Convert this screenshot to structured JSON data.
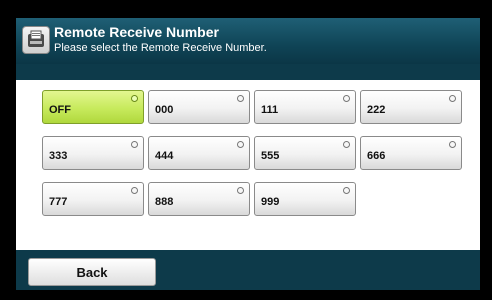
{
  "header": {
    "title": "Remote Receive Number",
    "subtitle": "Please select the Remote Receive Number.",
    "icon": "fax-document-icon"
  },
  "options": [
    {
      "label": "OFF",
      "selected": true
    },
    {
      "label": "000",
      "selected": false
    },
    {
      "label": "111",
      "selected": false
    },
    {
      "label": "222",
      "selected": false
    },
    {
      "label": "333",
      "selected": false
    },
    {
      "label": "444",
      "selected": false
    },
    {
      "label": "555",
      "selected": false
    },
    {
      "label": "666",
      "selected": false
    },
    {
      "label": "777",
      "selected": false
    },
    {
      "label": "888",
      "selected": false
    },
    {
      "label": "999",
      "selected": false
    }
  ],
  "footer": {
    "back_label": "Back"
  },
  "colors": {
    "selected": "#c7ea5c",
    "header": "#0f4456"
  }
}
